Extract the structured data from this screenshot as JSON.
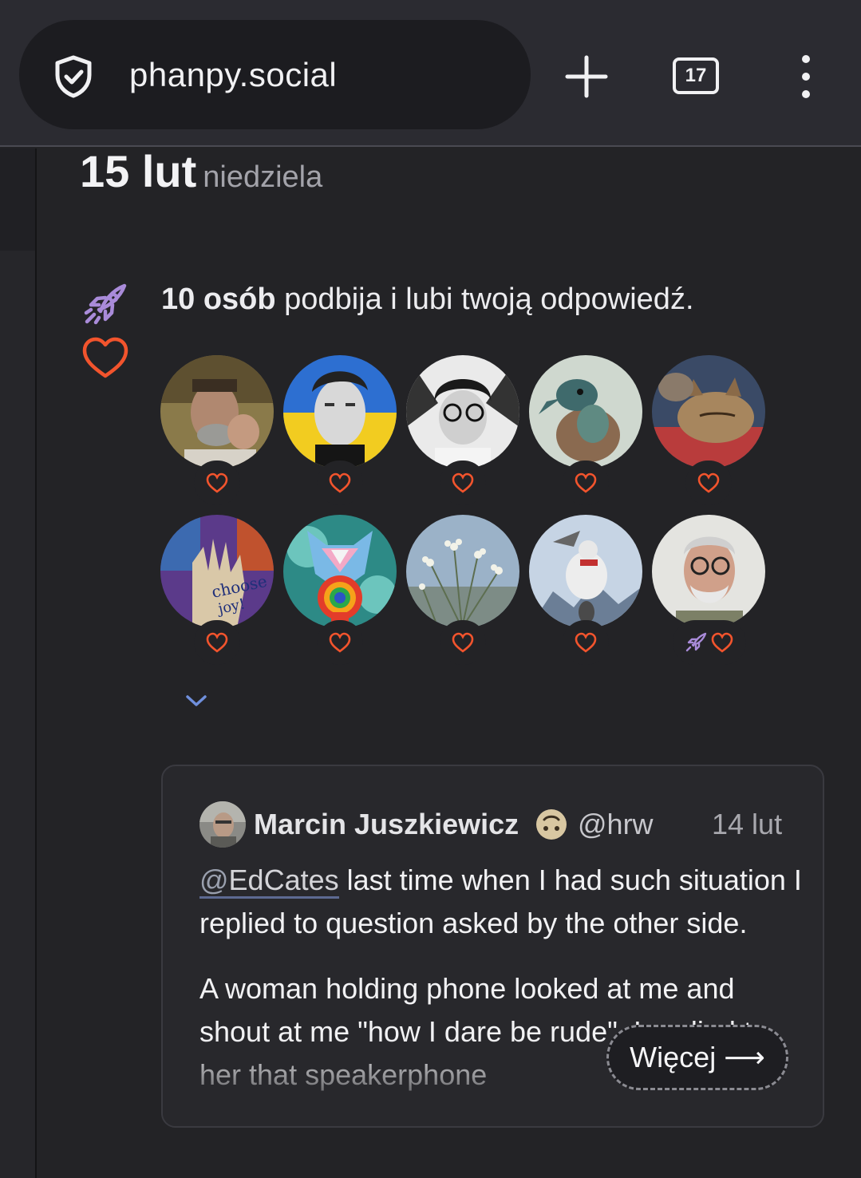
{
  "browser": {
    "url": "phanpy.social",
    "tab_count": "17",
    "icons": [
      "shield-check-icon",
      "plus-icon",
      "tabs-icon",
      "kebab-menu-icon"
    ]
  },
  "date_header": {
    "day": "15 lut",
    "weekday": "niedziela"
  },
  "notification": {
    "count_text": "10 osób",
    "action_text": " podbija i lubi twoją odpowiedź.",
    "icons": [
      "rocket-icon",
      "heart-icon"
    ],
    "avatars": [
      {
        "reaction": [
          "heart"
        ]
      },
      {
        "reaction": [
          "heart"
        ]
      },
      {
        "reaction": [
          "heart"
        ]
      },
      {
        "reaction": [
          "heart"
        ]
      },
      {
        "reaction": [
          "heart"
        ]
      },
      {
        "reaction": [
          "heart"
        ]
      },
      {
        "reaction": [
          "heart"
        ]
      },
      {
        "reaction": [
          "heart"
        ]
      },
      {
        "reaction": [
          "heart"
        ]
      },
      {
        "reaction": [
          "boost",
          "heart"
        ]
      }
    ]
  },
  "quoted_post": {
    "author": "Marcin Juszkiewicz",
    "handle": "@hrw",
    "time": "14 lut",
    "mention_at": "@",
    "mention_name": "EdCates",
    "para1_rest": " last time when I had such situation I replied to question asked by the other side.",
    "para2": "A woman holding phone looked at me and shout at me \"how I dare be rude\". I replied to her that speakerphone",
    "more_label": "Więcej ⟶"
  },
  "colors": {
    "background": "#232326",
    "heart": "#f2542d",
    "boost": "#a98bd9",
    "link": "#6f8fdc"
  }
}
